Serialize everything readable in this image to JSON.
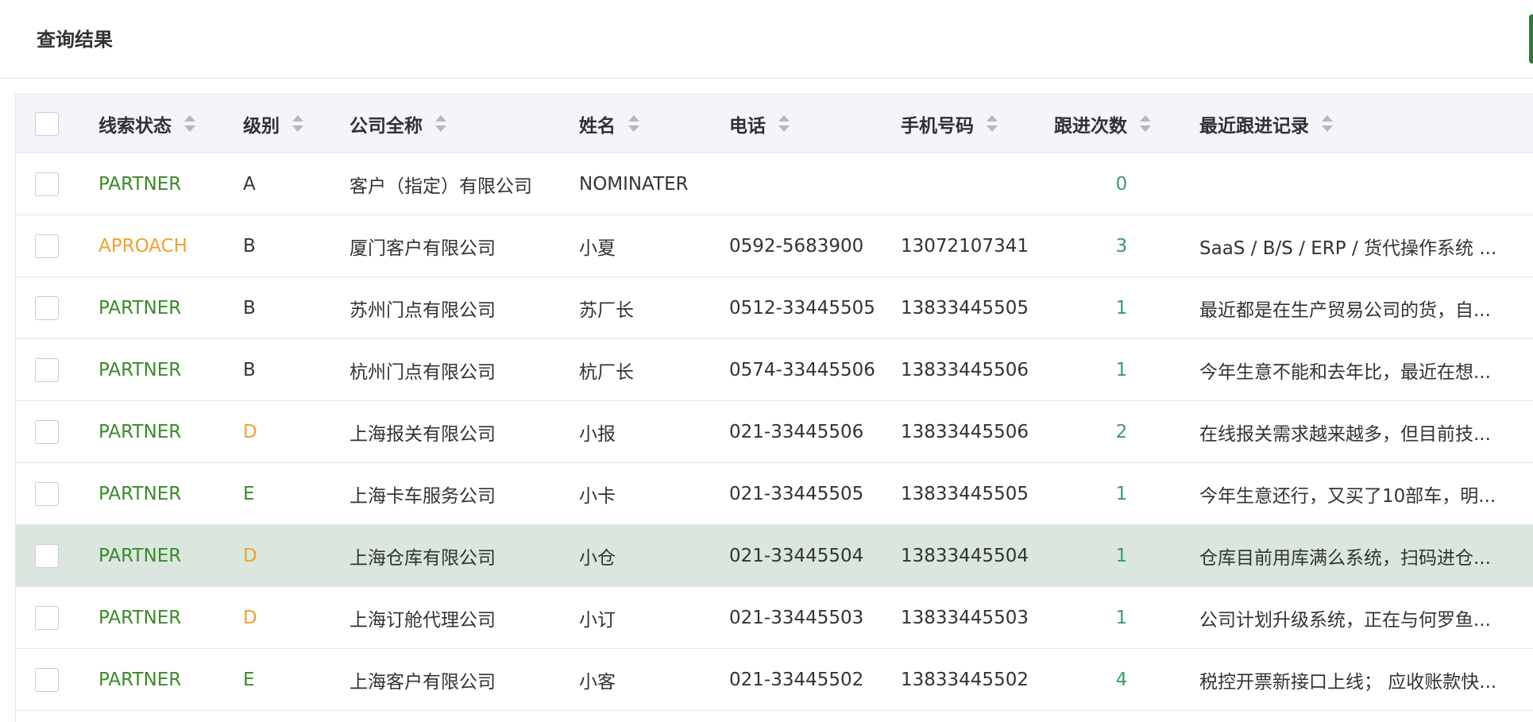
{
  "header": {
    "title": "查询结果"
  },
  "colors": {
    "status_partner": "#3a8a2a",
    "status_aproach": "#f0a030",
    "count": "#3a9a6a",
    "highlight_row": "#dbe7de"
  },
  "table": {
    "columns": [
      "线索状态",
      "级别",
      "公司全称",
      "姓名",
      "电话",
      "手机号码",
      "跟进次数",
      "最近跟进记录"
    ],
    "rows": [
      {
        "status": "PARTNER",
        "level": "A",
        "company": "客户（指定）有限公司",
        "name": "NOMINATER",
        "phone": "",
        "mobile": "",
        "count": "0",
        "record": ""
      },
      {
        "status": "APROACH",
        "level": "B",
        "company": "厦门客户有限公司",
        "name": "小夏",
        "phone": "0592-5683900",
        "mobile": "13072107341",
        "count": "3",
        "record": "SaaS / B/S / ERP / 货代操作系统 ..."
      },
      {
        "status": "PARTNER",
        "level": "B",
        "company": "苏州门点有限公司",
        "name": "苏厂长",
        "phone": "0512-33445505",
        "mobile": "13833445505",
        "count": "1",
        "record": "最近都是在生产贸易公司的货，自..."
      },
      {
        "status": "PARTNER",
        "level": "B",
        "company": "杭州门点有限公司",
        "name": "杭厂长",
        "phone": "0574-33445506",
        "mobile": "13833445506",
        "count": "1",
        "record": "今年生意不能和去年比，最近在想..."
      },
      {
        "status": "PARTNER",
        "level": "D",
        "company": "上海报关有限公司",
        "name": "小报",
        "phone": "021-33445506",
        "mobile": "13833445506",
        "count": "2",
        "record": "在线报关需求越来越多，但目前技..."
      },
      {
        "status": "PARTNER",
        "level": "E",
        "company": "上海卡车服务公司",
        "name": "小卡",
        "phone": "021-33445505",
        "mobile": "13833445505",
        "count": "1",
        "record": "今年生意还行，又买了10部车，明..."
      },
      {
        "status": "PARTNER",
        "level": "D",
        "company": "上海仓库有限公司",
        "name": "小仓",
        "phone": "021-33445504",
        "mobile": "13833445504",
        "count": "1",
        "record": "仓库目前用库满么系统，扫码进仓..."
      },
      {
        "status": "PARTNER",
        "level": "D",
        "company": "上海订舱代理公司",
        "name": "小订",
        "phone": "021-33445503",
        "mobile": "13833445503",
        "count": "1",
        "record": "公司计划升级系统，正在与何罗鱼..."
      },
      {
        "status": "PARTNER",
        "level": "E",
        "company": "上海客户有限公司",
        "name": "小客",
        "phone": "021-33445502",
        "mobile": "13833445502",
        "count": "4",
        "record": "税控开票新接口上线； 应收账款快..."
      }
    ]
  }
}
